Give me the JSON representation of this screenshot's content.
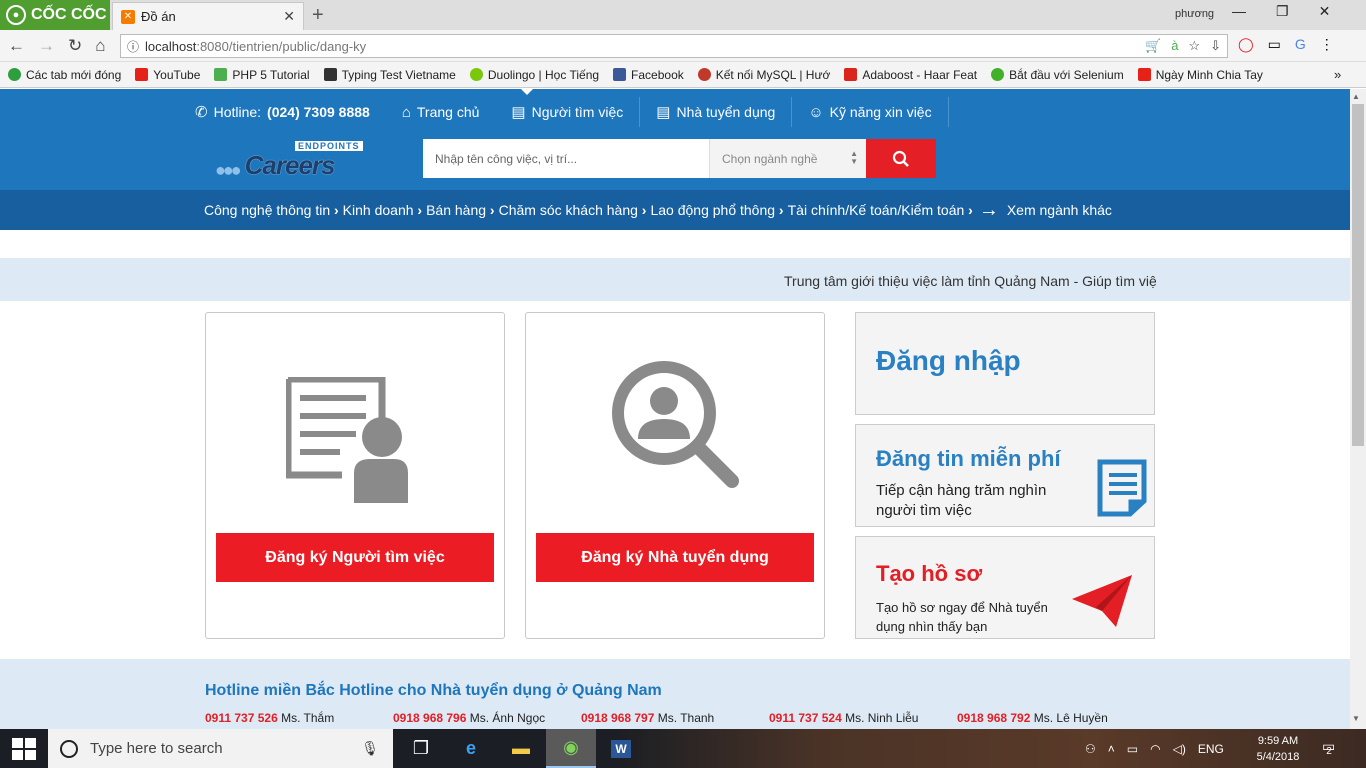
{
  "browser": {
    "brand": "CỐC CỐC",
    "tab_title": "Đồ án",
    "profile": "phương",
    "url_host": "localhost",
    "url_rest": ":8080/tientrien/public/dang-ky",
    "bookmarks": [
      {
        "label": "Các tab mới đóng",
        "color": "#2e9e3e"
      },
      {
        "label": "YouTube",
        "color": "#e62117"
      },
      {
        "label": "PHP 5 Tutorial",
        "color": "#4caf50"
      },
      {
        "label": "Typing Test Vietname",
        "color": "#333333"
      },
      {
        "label": "Duolingo | Học Tiếng",
        "color": "#7ac70c"
      },
      {
        "label": "Facebook",
        "color": "#3b5998"
      },
      {
        "label": "Kết nối MySQL | Hướ",
        "color": "#c0392b"
      },
      {
        "label": "Adaboost - Haar Feat",
        "color": "#da251d"
      },
      {
        "label": "Bắt đầu với Selenium",
        "color": "#43b02a"
      },
      {
        "label": "Ngày Minh Chia Tay",
        "color": "#e62117"
      }
    ]
  },
  "header": {
    "hotline_label": "Hotline:",
    "hotline_number": "(024) 7309 8888",
    "nav": [
      "Trang chủ",
      "Người tìm việc",
      "Nhà tuyển dụng",
      "Kỹ năng xin việc"
    ],
    "logo_top": "ENDPOINTS",
    "logo_main": "Careers",
    "search_placeholder": "Nhập tên công việc, vị trí...",
    "category_placeholder": "Chọn ngành nghề",
    "categories": [
      "Công nghệ thông tin",
      "Kinh doanh",
      "Bán hàng",
      "Chăm sóc khách hàng",
      "Lao động phổ thông",
      "Tài chính/Kế toán/Kiểm toán"
    ],
    "more_categories": "Xem ngành khác"
  },
  "marquee": "Trung tâm giới thiệu việc làm tỉnh Quảng Nam - Giúp tìm việ",
  "register": {
    "jobseeker_button": "Đăng ký Người tìm việc",
    "employer_button": "Đăng ký Nhà tuyển dụng"
  },
  "side": {
    "login": "Đăng nhập",
    "post_title": "Đăng tin miễn phí",
    "post_desc": "Tiếp cận hàng trăm nghìn người tìm việc",
    "profile_title": "Tạo hồ sơ",
    "profile_desc": "Tạo hồ sơ ngay để Nhà tuyển dụng nhìn thấy bạn"
  },
  "footer": {
    "title": "Hotline miền Bắc Hotline cho Nhà tuyển dụng ở Quảng Nam",
    "contacts": [
      {
        "phone": "0911 737 526",
        "name": "Ms. Thắm"
      },
      {
        "phone": "0918 968 796",
        "name": "Ms. Ánh Ngọc"
      },
      {
        "phone": "0918 968 797",
        "name": "Ms. Thanh"
      },
      {
        "phone": "0911 737 524",
        "name": "Ms. Ninh Liễu"
      },
      {
        "phone": "0918 968 792",
        "name": "Ms. Lê Huyền"
      }
    ]
  },
  "taskbar": {
    "search_placeholder": "Type here to search",
    "lang": "ENG",
    "time": "9:59 AM",
    "date": "5/4/2018",
    "notifications": "2"
  },
  "colors": {
    "brand_blue": "#1e76bc",
    "accent_red": "#ec1c24",
    "dark_blue": "#175f9e"
  }
}
